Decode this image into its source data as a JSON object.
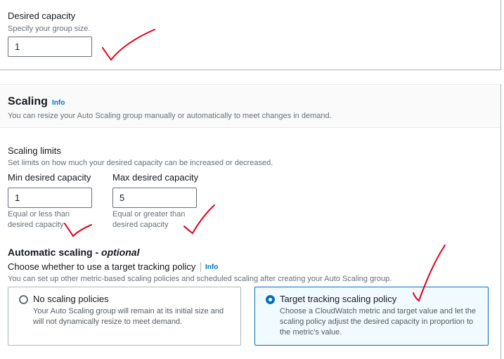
{
  "desired_capacity": {
    "label": "Desired capacity",
    "description": "Specify your group size.",
    "value": "1"
  },
  "scaling": {
    "title": "Scaling",
    "info_link": "Info",
    "description": "You can resize your Auto Scaling group manually or automatically to meet changes in demand."
  },
  "scaling_limits": {
    "label": "Scaling limits",
    "description": "Set limits on how much your desired capacity can be increased or decreased.",
    "min": {
      "label": "Min desired capacity",
      "value": "1",
      "hint": "Equal or less than desired capacity"
    },
    "max": {
      "label": "Max desired capacity",
      "value": "5",
      "hint": "Equal or greater than desired capacity"
    }
  },
  "automatic_scaling": {
    "title": "Automatic scaling - ",
    "title_optional": "optional",
    "choose_label": "Choose whether to use a target tracking policy",
    "info_link": "Info",
    "description": "You can set up other metric-based scaling policies and scheduled scaling after creating your Auto Scaling group.",
    "options": [
      {
        "title": "No scaling policies",
        "description": "Your Auto Scaling group will remain at its initial size and will not dynamically resize to meet demand.",
        "selected": false
      },
      {
        "title": "Target tracking scaling policy",
        "description": "Choose a CloudWatch metric and target value and let the scaling policy adjust the desired capacity in proportion to the metric's value.",
        "selected": true
      }
    ]
  },
  "colors": {
    "accent": "#0073bb",
    "annotation": "#e0001b"
  }
}
